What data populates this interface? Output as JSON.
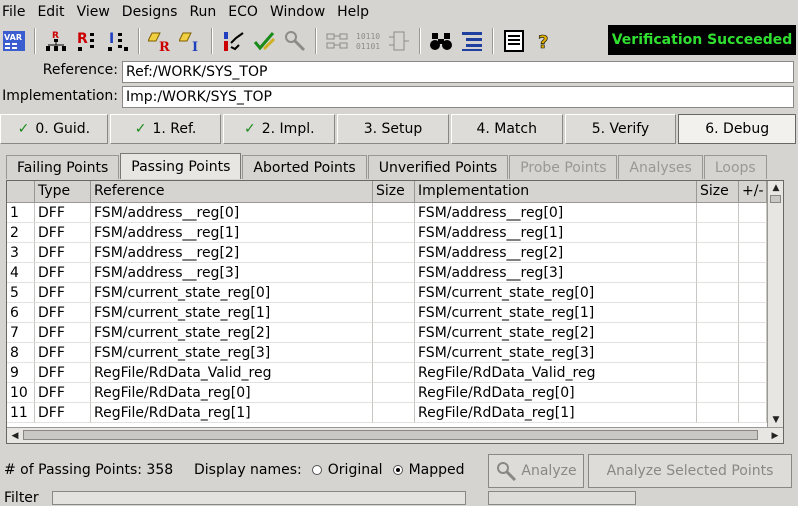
{
  "menu": [
    "File",
    "Edit",
    "View",
    "Designs",
    "Run",
    "ECO",
    "Window",
    "Help"
  ],
  "toolbar_icons": [
    {
      "name": "var-icon",
      "dim": false
    },
    {
      "name": "ref-hierarchy-icon",
      "dim": false
    },
    {
      "name": "ref-r-hierarchy-icon",
      "dim": false
    },
    {
      "name": "impl-hierarchy-icon",
      "dim": false
    },
    {
      "name": "ref-eraser-icon",
      "dim": false
    },
    {
      "name": "impl-eraser-icon",
      "dim": false
    },
    {
      "name": "debug-run-icon",
      "dim": false
    },
    {
      "name": "verify-check-icon",
      "dim": false
    },
    {
      "name": "analyze-wrench-icon",
      "dim": true
    },
    {
      "name": "compare-points-icon",
      "dim": true
    },
    {
      "name": "binary-pattern-icon",
      "dim": true
    },
    {
      "name": "schematic-icon",
      "dim": true
    },
    {
      "name": "binoculars-icon",
      "dim": false
    },
    {
      "name": "hierarchy-list-icon",
      "dim": false
    },
    {
      "name": "transcript-icon",
      "dim": false
    },
    {
      "name": "help-icon",
      "dim": false
    }
  ],
  "status_banner": "Verification Succeeded",
  "reference": {
    "label": "Reference:",
    "value": "Ref:/WORK/SYS_TOP"
  },
  "implementation": {
    "label": "Implementation:",
    "value": "Imp:/WORK/SYS_TOP"
  },
  "steps": [
    {
      "label": "0. Guid.",
      "checked": true
    },
    {
      "label": "1. Ref.",
      "checked": true
    },
    {
      "label": "2. Impl.",
      "checked": true
    },
    {
      "label": "3. Setup",
      "checked": false
    },
    {
      "label": "4. Match",
      "checked": false
    },
    {
      "label": "5. Verify",
      "checked": false
    },
    {
      "label": "6. Debug",
      "checked": false,
      "active": true
    }
  ],
  "tabs": [
    {
      "label": "Failing Points",
      "state": "normal"
    },
    {
      "label": "Passing Points",
      "state": "active"
    },
    {
      "label": "Aborted Points",
      "state": "normal"
    },
    {
      "label": "Unverified Points",
      "state": "normal"
    },
    {
      "label": "Probe Points",
      "state": "disabled"
    },
    {
      "label": "Analyses",
      "state": "disabled"
    },
    {
      "label": "Loops",
      "state": "disabled"
    }
  ],
  "table": {
    "headers": [
      "",
      "Type",
      "Reference",
      "Size",
      "Implementation",
      "Size",
      "+/-"
    ],
    "rows": [
      [
        "1",
        "DFF",
        "FSM/address__reg[0]",
        "",
        "FSM/address__reg[0]",
        "",
        ""
      ],
      [
        "2",
        "DFF",
        "FSM/address__reg[1]",
        "",
        "FSM/address__reg[1]",
        "",
        ""
      ],
      [
        "3",
        "DFF",
        "FSM/address__reg[2]",
        "",
        "FSM/address__reg[2]",
        "",
        ""
      ],
      [
        "4",
        "DFF",
        "FSM/address__reg[3]",
        "",
        "FSM/address__reg[3]",
        "",
        ""
      ],
      [
        "5",
        "DFF",
        "FSM/current_state_reg[0]",
        "",
        "FSM/current_state_reg[0]",
        "",
        ""
      ],
      [
        "6",
        "DFF",
        "FSM/current_state_reg[1]",
        "",
        "FSM/current_state_reg[1]",
        "",
        ""
      ],
      [
        "7",
        "DFF",
        "FSM/current_state_reg[2]",
        "",
        "FSM/current_state_reg[2]",
        "",
        ""
      ],
      [
        "8",
        "DFF",
        "FSM/current_state_reg[3]",
        "",
        "FSM/current_state_reg[3]",
        "",
        ""
      ],
      [
        "9",
        "DFF",
        "RegFile/RdData_Valid_reg",
        "",
        "RegFile/RdData_Valid_reg",
        "",
        ""
      ],
      [
        "10",
        "DFF",
        "RegFile/RdData_reg[0]",
        "",
        "RegFile/RdData_reg[0]",
        "",
        ""
      ],
      [
        "11",
        "DFF",
        "RegFile/RdData_reg[1]",
        "",
        "RegFile/RdData_reg[1]",
        "",
        ""
      ]
    ]
  },
  "footer": {
    "passing_count": "# of Passing Points: 358",
    "display_names_label": "Display names:",
    "option_original": "Original",
    "option_mapped": "Mapped",
    "selected": "Mapped",
    "analyze_button": "Analyze",
    "analyze_selected_button": "Analyze Selected Points",
    "filter_label": "Filter"
  },
  "colors": {
    "status_bg": "#000000",
    "status_fg": "#30e030",
    "check": "#1a8a1a"
  }
}
